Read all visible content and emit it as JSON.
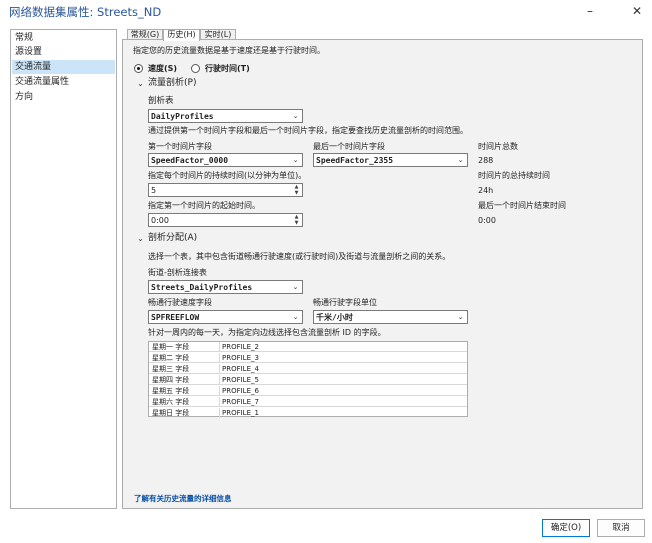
{
  "window": {
    "title": "网络数据集属性: Streets_ND",
    "minimize_glyph": "–",
    "close_glyph": "✕"
  },
  "sidebar": {
    "items": [
      {
        "label": "常规"
      },
      {
        "label": "源设置"
      },
      {
        "label": "交通流量"
      },
      {
        "label": "交通流量属性"
      },
      {
        "label": "方向"
      }
    ],
    "active_index": 2
  },
  "tabs": [
    {
      "label": "常规(G)"
    },
    {
      "label": "历史(H)"
    },
    {
      "label": "实时(L)"
    }
  ],
  "active_tab": 1,
  "history": {
    "intro": "指定您的历史流量数据是基于速度还是基于行驶时间。",
    "radio_speed": "速度(S)",
    "radio_travel_time": "行驶时间(T)",
    "selected_radio": "speed",
    "profiles_section": "流量剖析(P)",
    "profile_table_label": "剖析表",
    "profile_table_value": "DailyProfiles",
    "profile_desc": "通过提供第一个时间片字段和最后一个时间片字段，指定要查找历史流量剖析的时间范围。",
    "first_slice_label": "第一个时间片字段",
    "first_slice_value": "SpeedFactor_0000",
    "last_slice_label": "最后一个时间片字段",
    "last_slice_value": "SpeedFactor_2355",
    "total_slices_label": "时间片总数",
    "total_slices_value": "288",
    "duration_label": "指定每个时间片的持续时间(以分钟为单位)。",
    "duration_value": "5",
    "total_duration_label": "时间片的总持续时间",
    "total_duration_value": "24h",
    "start_label": "指定第一个时间片的起始时间。",
    "start_value": "0:00",
    "end_label": "最后一个时间片结束时间",
    "end_value": "0:00",
    "assignment_section": "剖析分配(A)",
    "assignment_desc": "选择一个表，其中包含街道畅通行驶速度(或行驶时间)及街道与流量剖析之间的关系。",
    "join_table_label": "街道-剖析连接表",
    "join_table_value": "Streets_DailyProfiles",
    "freeflow_label": "畅通行驶速度字段",
    "freeflow_value": "SPFREEFLOW",
    "unit_label": "畅通行驶字段单位",
    "unit_value": "千米/小时",
    "weekday_desc": "针对一周内的每一天，为指定向边线选择包含流量剖析 ID 的字段。",
    "weekday_rows": [
      {
        "day": "星期一 字段",
        "field": "PROFILE_2"
      },
      {
        "day": "星期二 字段",
        "field": "PROFILE_3"
      },
      {
        "day": "星期三 字段",
        "field": "PROFILE_4"
      },
      {
        "day": "星期四 字段",
        "field": "PROFILE_5"
      },
      {
        "day": "星期五 字段",
        "field": "PROFILE_6"
      },
      {
        "day": "星期六 字段",
        "field": "PROFILE_7"
      },
      {
        "day": "星期日 字段",
        "field": "PROFILE_1"
      }
    ],
    "learn_more": "了解有关历史流量的详细信息"
  },
  "footer": {
    "ok": "确定(O)",
    "cancel": "取消"
  }
}
